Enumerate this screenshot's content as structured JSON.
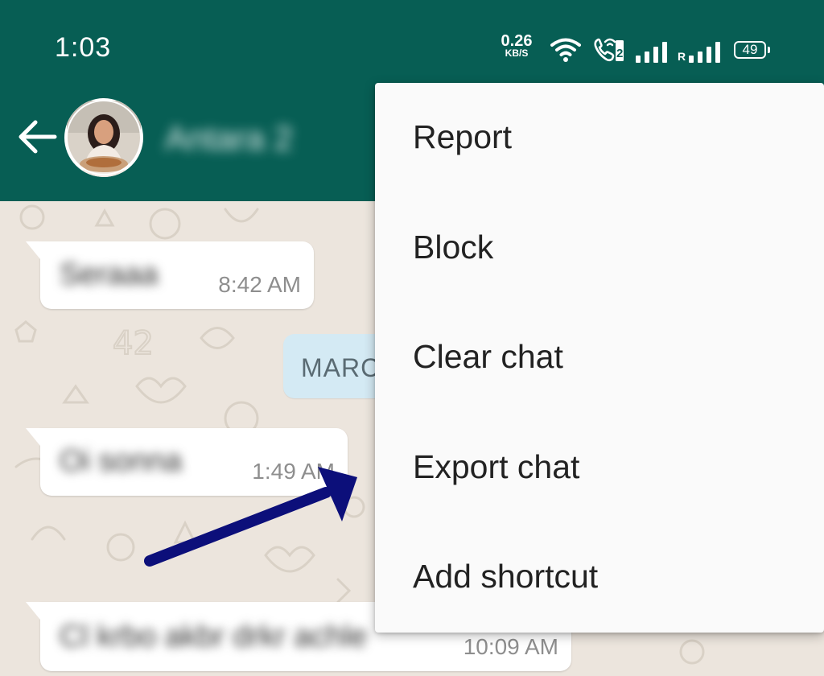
{
  "status_bar": {
    "time": "1:03",
    "net_speed_value": "0.26",
    "net_speed_unit": "KB/S",
    "battery_level": "49",
    "roaming_label": "R",
    "sim_label": "2"
  },
  "header": {
    "contact_name": "Antara 2",
    "icons": {
      "back": "arrow-left-icon",
      "avatar": "contact-avatar"
    }
  },
  "messages": [
    {
      "text": "Seraaa",
      "time": "8:42 AM"
    },
    {
      "text": "Oi sonna",
      "time": "1:49 AM"
    },
    {
      "text": "Cl krbo akbr drkr achle",
      "time": "10:09 AM"
    }
  ],
  "date_chip": {
    "label": "MARC"
  },
  "menu": {
    "items": [
      {
        "label": "Report"
      },
      {
        "label": "Block"
      },
      {
        "label": "Clear chat"
      },
      {
        "label": "Export chat"
      },
      {
        "label": "Add shortcut"
      }
    ]
  },
  "colors": {
    "header": "#075e54",
    "wallpaper": "#ece5dd",
    "menu_bg": "#fafafa",
    "annotation_arrow": "#0c0f7a"
  }
}
